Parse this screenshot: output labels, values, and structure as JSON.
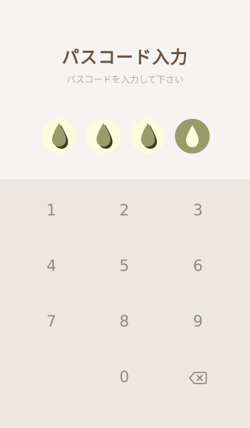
{
  "header": {
    "title": "パスコード入力",
    "subtitle": "パスコードを入力して下さい"
  },
  "passcode": {
    "length": 4,
    "entered": 3,
    "filled_icon": "water-drop-filled-icon",
    "empty_icon": "water-drop-outline-icon"
  },
  "keypad": {
    "keys": [
      "1",
      "2",
      "3",
      "4",
      "5",
      "6",
      "7",
      "8",
      "9",
      "0"
    ],
    "delete_icon": "backspace-icon"
  },
  "colors": {
    "title": "#6b5240",
    "subtitle": "#b4aca6",
    "top_background": "#f7f3f1",
    "keypad_background": "#ece7e1",
    "key_text": "#918a84",
    "dot_filled_bg": "#fcfbdc",
    "dot_empty_bg": "#9a9b6a",
    "drop_color": "#9a9b6a",
    "drop_shadow": "#3a3a28"
  }
}
